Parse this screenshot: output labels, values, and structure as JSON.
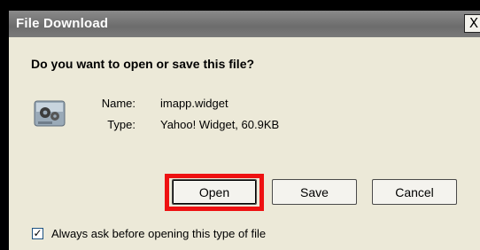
{
  "dialog": {
    "title": "File Download",
    "close_glyph": "X",
    "question": "Do you want to open or save this file?",
    "icon": "widget-file-icon",
    "name_label": "Name:",
    "name_value": "imapp.widget",
    "type_label": "Type:",
    "type_value": "Yahoo! Widget, 60.9KB"
  },
  "buttons": {
    "open": "Open",
    "save": "Save",
    "cancel": "Cancel"
  },
  "checkbox": {
    "checked": true,
    "mark": "✓",
    "label": "Always ask before opening this type of file"
  },
  "colors": {
    "highlight": "#ee1111",
    "dialog_bg": "#ece9d8",
    "titlebar": "#7a7a7a"
  }
}
